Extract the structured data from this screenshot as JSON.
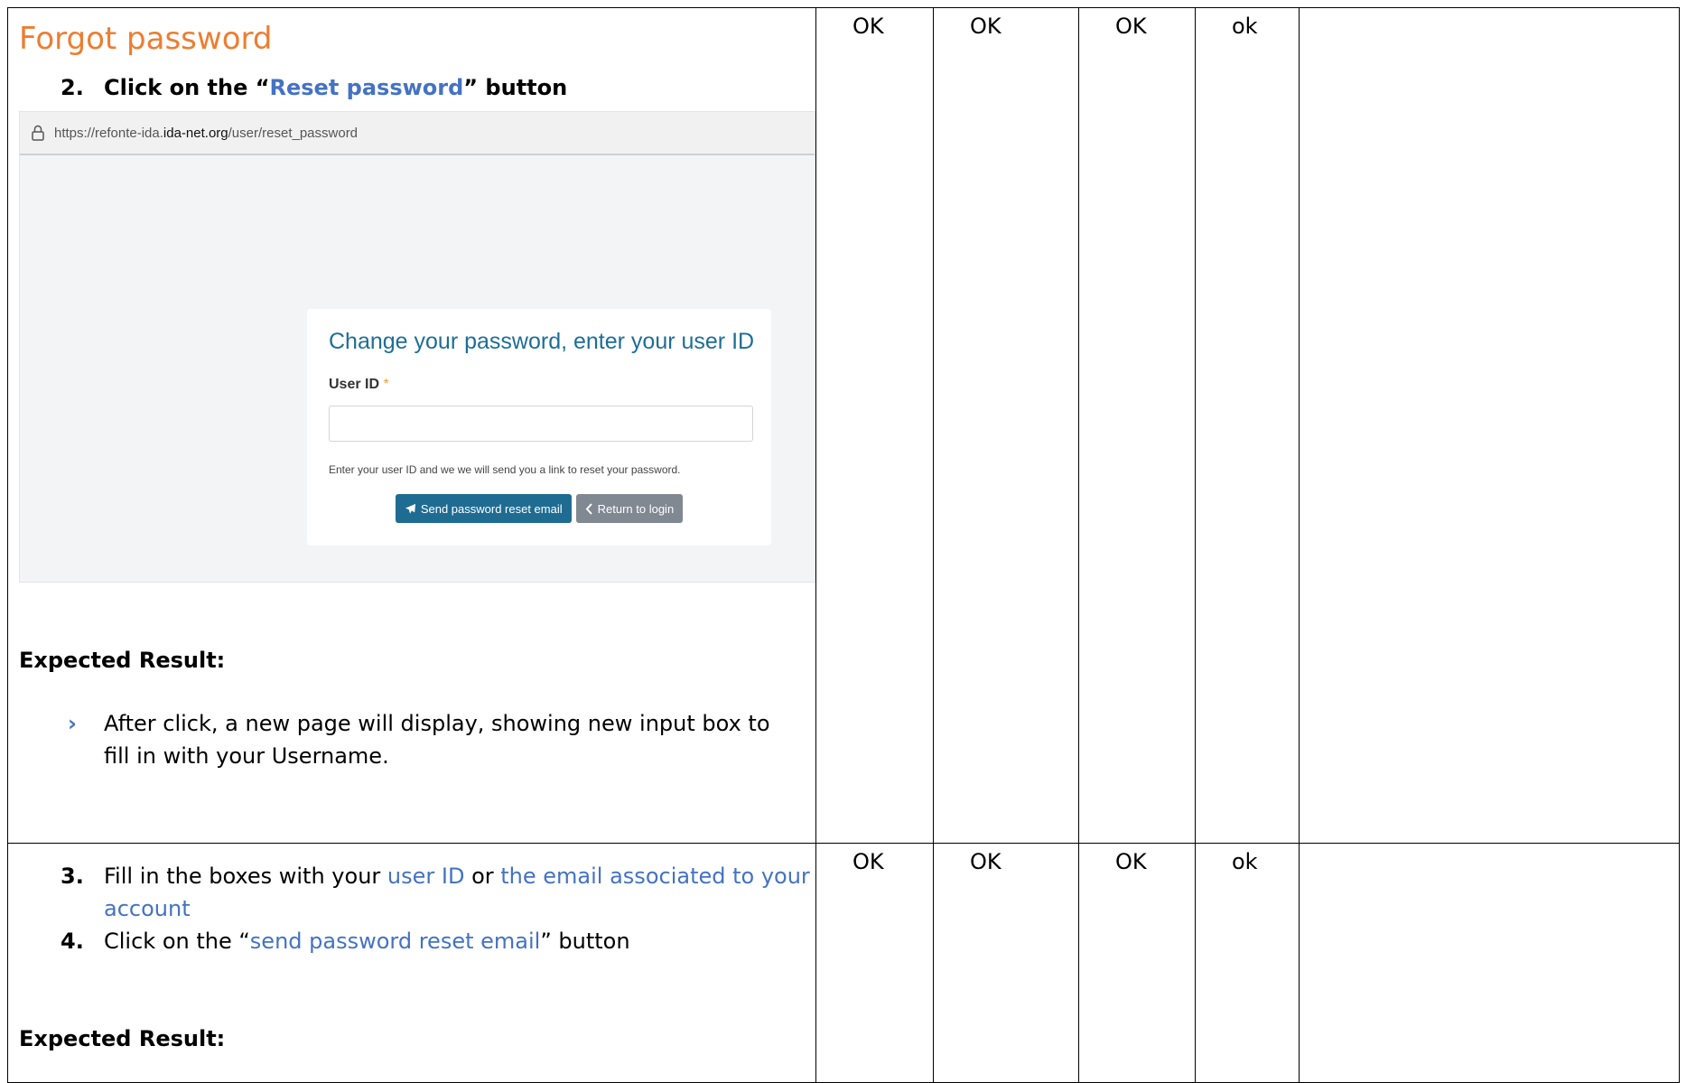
{
  "section1": {
    "title": "Forgot password",
    "step_num": "2.",
    "step_prefix": "Click on the “",
    "step_link": "Reset password",
    "step_suffix": "” button",
    "browser": {
      "url_prefix": "https://refonte-ida.",
      "url_domain": "ida-net.org",
      "url_path": "/user/reset_password"
    },
    "form": {
      "heading": "Change your password, enter your user ID",
      "field_label": "User ID",
      "required_mark": "*",
      "help": "Enter your user ID and we we will send you a link to reset your password.",
      "send_button": "Send password reset email",
      "return_button": "Return to login"
    },
    "expected_label": "Expected Result:",
    "bullet": "After click, a new page will display, showing new input box to fill in with your Username.",
    "results": [
      "OK",
      "OK",
      "OK",
      "ok"
    ]
  },
  "section2": {
    "step3_num": "3.",
    "step3_text": "Fill in the boxes with your ",
    "step3_link1": "user ID",
    "step3_or": " or ",
    "step3_link2": "the email associated to your account",
    "step4_num": "4.",
    "step4_prefix": "Click on the “",
    "step4_link": "send password reset email",
    "step4_suffix": "” button",
    "expected_label": "Expected Result:",
    "results": [
      "OK",
      "OK",
      "OK",
      "ok"
    ]
  },
  "colors": {
    "title_orange": "#ED7D31",
    "link_blue": "#4472C4",
    "form_heading": "#1d6e96",
    "primary_button": "#1f6c92",
    "secondary_button": "#808891"
  },
  "icons": [
    "lock-icon",
    "paper-plane-icon",
    "chevron-left-icon",
    "chevron-right-bullet-icon"
  ]
}
